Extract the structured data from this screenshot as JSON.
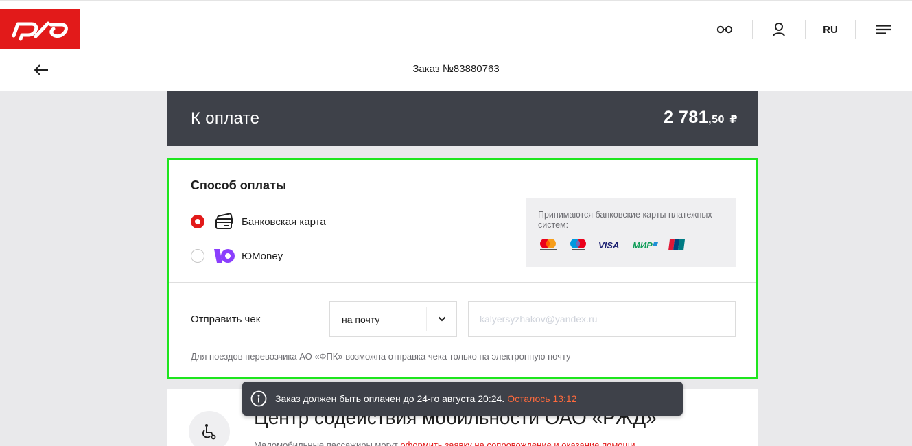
{
  "header": {
    "logo_text": "РЖД",
    "language": "RU",
    "icons": [
      "glasses-icon",
      "user-icon",
      "menu-icon"
    ]
  },
  "subheader": {
    "order_title": "Заказ №83880763"
  },
  "payment_header": {
    "label": "К оплате",
    "amount_main": "2 781",
    "amount_kop": ",50",
    "currency": "₽"
  },
  "payment_method": {
    "title": "Способ оплаты",
    "options": [
      {
        "label": "Банковская карта",
        "selected": true,
        "icon": "bank-card-icon"
      },
      {
        "label": "ЮMoney",
        "selected": false,
        "icon": "yoomoney-icon"
      }
    ],
    "accepted_text": "Принимаются банковские карты платежных систем:",
    "card_brands": [
      "mastercard",
      "maestro",
      "VISA",
      "МИР",
      "UnionPay"
    ]
  },
  "receipt": {
    "label": "Отправить чек",
    "select_value": "на почту",
    "email_value": "kalyersyzhakov@yandex.ru",
    "note": "Для поездов перевозчика АО «ФПК» возможна отправка чека только на электронную почту"
  },
  "mobility_center": {
    "title": "Центр содействия мобильности ОАО «РЖД»",
    "text_prefix": "Маломобильные пассажиры могут ",
    "text_link": "оформить заявку на сопровождение и оказание помощи"
  },
  "toast": {
    "message": "Заказ должен быть оплачен до 24-го августа 20:24.",
    "remaining": "Осталось 13:12"
  },
  "colors": {
    "brand_red": "#e21a1a",
    "dark_panel": "#3e4149",
    "highlight_green": "#1ee51e",
    "remaining_orange": "#ff6a3d",
    "yoomoney_purple": "#8b3ffd"
  }
}
